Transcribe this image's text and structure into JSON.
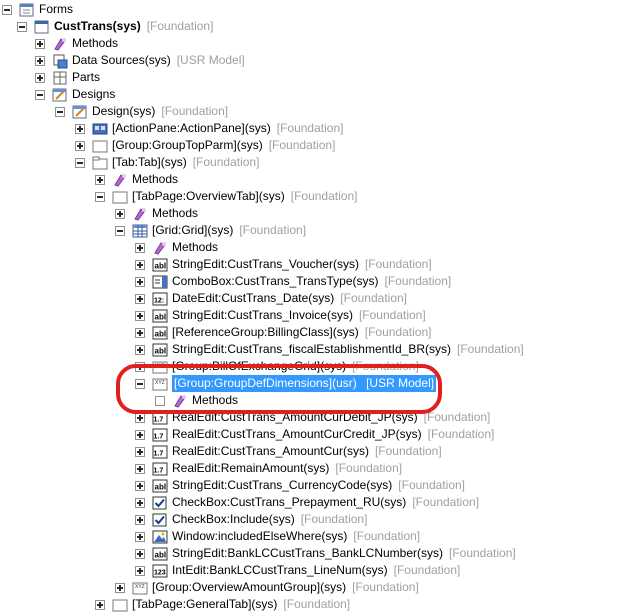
{
  "tree": {
    "forms": "Forms",
    "form": {
      "name": "CustTrans(sys)",
      "layer": "[Foundation]"
    },
    "methods": "Methods",
    "data_sources": {
      "name": "Data Sources(sys)",
      "layer": "[USR Model]"
    },
    "parts": "Parts",
    "designs": "Designs",
    "design": {
      "name": "Design(sys)",
      "layer": "[Foundation]"
    },
    "action_pane": {
      "name": "[ActionPane:ActionPane](sys)",
      "layer": "[Foundation]"
    },
    "group_top": {
      "name": "[Group:GroupTopParm](sys)",
      "layer": "[Foundation]"
    },
    "tab": {
      "name": "[Tab:Tab](sys)",
      "layer": "[Foundation]"
    },
    "tab_methods": "Methods",
    "overview_tab": {
      "name": "[TabPage:OverviewTab](sys)",
      "layer": "[Foundation]"
    },
    "overview_methods": "Methods",
    "grid": {
      "name": "[Grid:Grid](sys)",
      "layer": "[Foundation]"
    },
    "grid_methods": "Methods",
    "fields": [
      {
        "name": "StringEdit:CustTrans_Voucher(sys)",
        "layer": "[Foundation]",
        "icon": "abl"
      },
      {
        "name": "ComboBox:CustTrans_TransType(sys)",
        "layer": "[Foundation]",
        "icon": "combo"
      },
      {
        "name": "DateEdit:CustTrans_Date(sys)",
        "layer": "[Foundation]",
        "icon": "date"
      },
      {
        "name": "StringEdit:CustTrans_Invoice(sys)",
        "layer": "[Foundation]",
        "icon": "abl"
      },
      {
        "name": "[ReferenceGroup:BillingClass](sys)",
        "layer": "[Foundation]",
        "icon": "abl"
      },
      {
        "name": "StringEdit:CustTrans_fiscalEstablishmentId_BR(sys)",
        "layer": "[Foundation]",
        "icon": "abl"
      },
      {
        "name": "[Group:BillOfExchangeGrid](sys)",
        "layer": "[Foundation]",
        "icon": "group"
      }
    ],
    "selected_group": {
      "name": "[Group:GroupDefDimensions](usr)",
      "layer": "[USR Model]"
    },
    "selected_methods": "Methods",
    "fields2": [
      {
        "name": "RealEdit:CustTrans_AmountCurDebit_JP(sys)",
        "layer": "[Foundation]",
        "icon": "real"
      },
      {
        "name": "RealEdit:CustTrans_AmountCurCredit_JP(sys)",
        "layer": "[Foundation]",
        "icon": "real"
      },
      {
        "name": "RealEdit:CustTrans_AmountCur(sys)",
        "layer": "[Foundation]",
        "icon": "real"
      },
      {
        "name": "RealEdit:RemainAmount(sys)",
        "layer": "[Foundation]",
        "icon": "real"
      },
      {
        "name": "StringEdit:CustTrans_CurrencyCode(sys)",
        "layer": "[Foundation]",
        "icon": "abl"
      },
      {
        "name": "CheckBox:CustTrans_Prepayment_RU(sys)",
        "layer": "[Foundation]",
        "icon": "check"
      },
      {
        "name": "CheckBox:Include(sys)",
        "layer": "[Foundation]",
        "icon": "check"
      },
      {
        "name": "Window:includedElseWhere(sys)",
        "layer": "[Foundation]",
        "icon": "window"
      },
      {
        "name": "StringEdit:BankLCCustTrans_BankLCNumber(sys)",
        "layer": "[Foundation]",
        "icon": "abl"
      },
      {
        "name": "IntEdit:BankLCCustTrans_LineNum(sys)",
        "layer": "[Foundation]",
        "icon": "int"
      }
    ],
    "overview_amount": {
      "name": "[Group:OverviewAmountGroup](sys)",
      "layer": "[Foundation]"
    },
    "general_tab": {
      "name": "[TabPage:GeneralTab](sys)",
      "layer": "[Foundation]"
    }
  },
  "colors": {
    "selection": "#3399ff",
    "annotation": "#e0201f",
    "layer_text": "#a0a0a0"
  }
}
